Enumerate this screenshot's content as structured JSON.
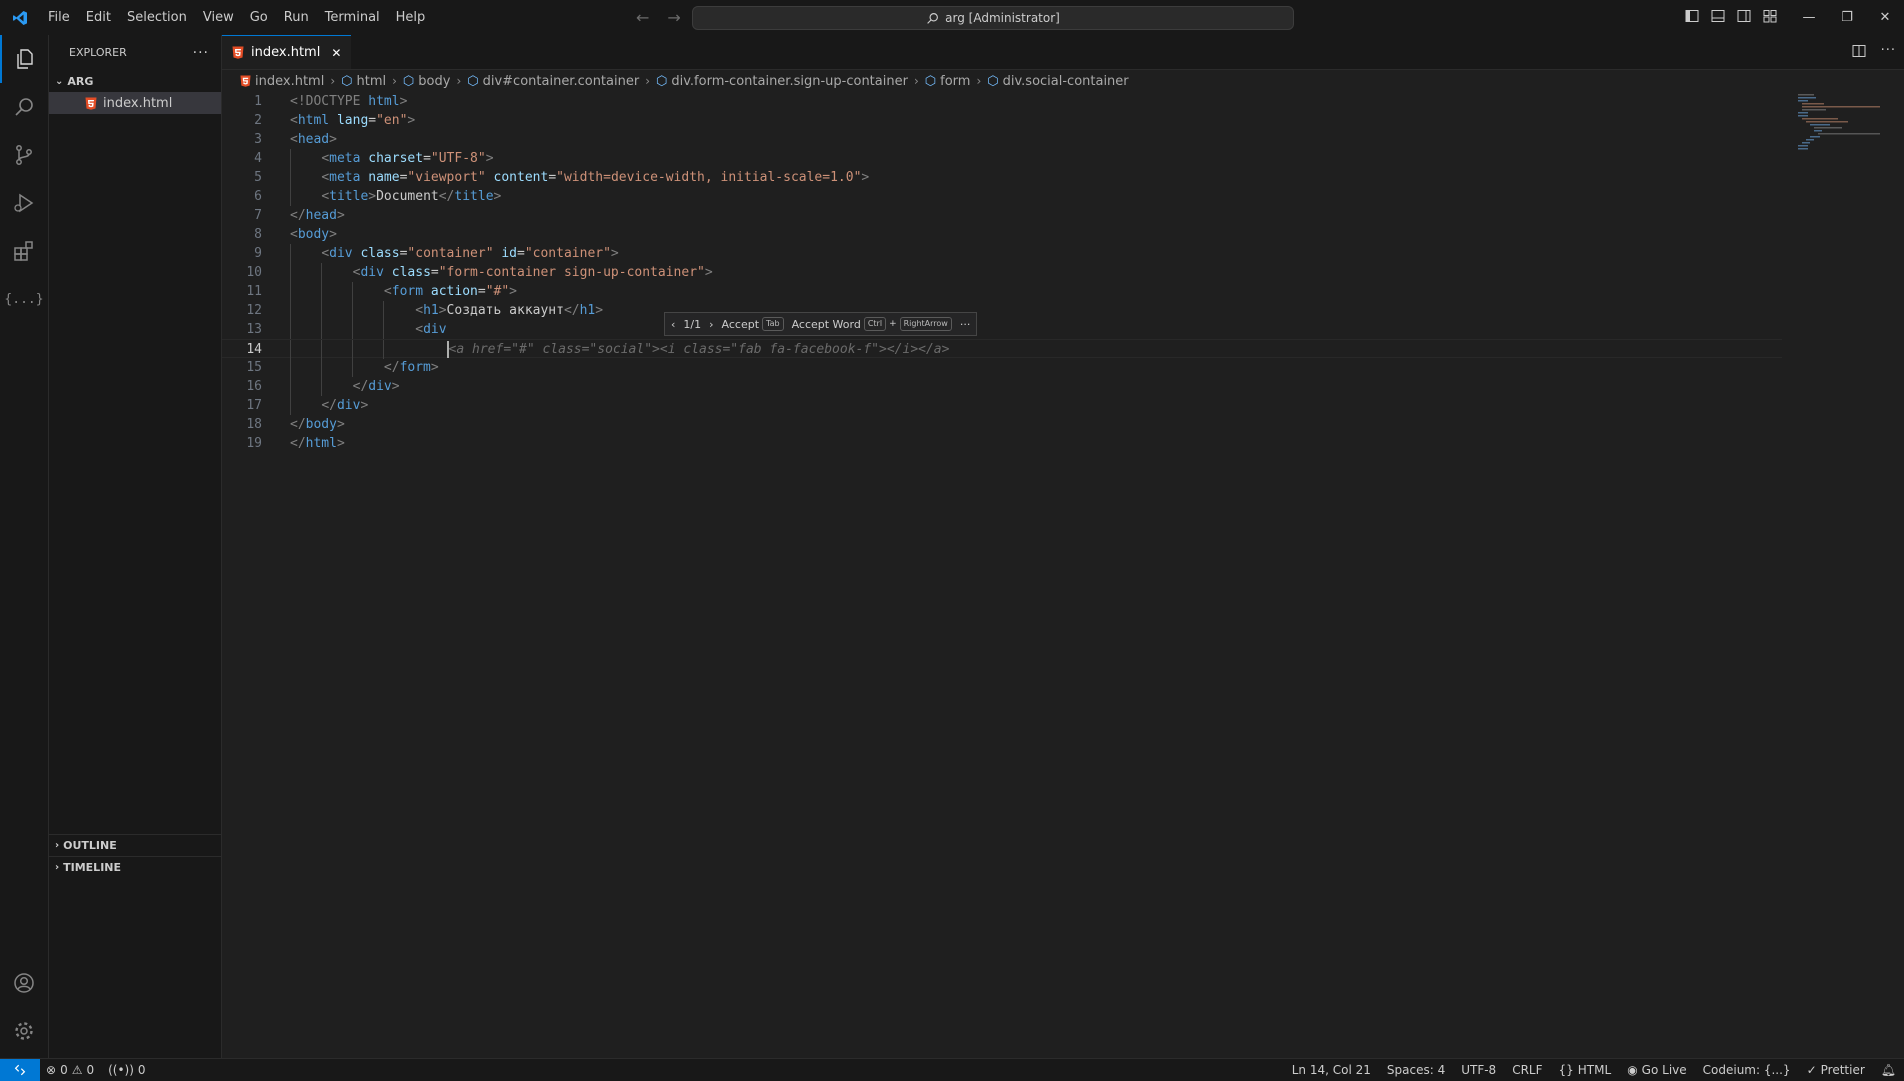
{
  "menu": [
    "File",
    "Edit",
    "Selection",
    "View",
    "Go",
    "Run",
    "Terminal",
    "Help"
  ],
  "command_center": "arg [Administrator]",
  "explorer": {
    "title": "EXPLORER",
    "folder": "ARG",
    "file": "index.html",
    "outline": "OUTLINE",
    "timeline": "TIMELINE"
  },
  "tab": {
    "label": "index.html"
  },
  "breadcrumb": [
    "index.html",
    "html",
    "body",
    "div#container.container",
    "div.form-container.sign-up-container",
    "form",
    "div.social-container"
  ],
  "code": {
    "l1_a": "<!DOCTYPE ",
    "l1_b": "html",
    "l1_c": ">",
    "l2_tag": "html",
    "l2_attr": "lang",
    "l2_val": "\"en\"",
    "l3_tag": "head",
    "l4_tag": "meta",
    "l4_attr": "charset",
    "l4_val": "\"UTF-8\"",
    "l5_tag": "meta",
    "l5_attr1": "name",
    "l5_val1": "\"viewport\"",
    "l5_attr2": "content",
    "l5_val2": "\"width=device-width, initial-scale=1.0\"",
    "l6_tag": "title",
    "l6_text": "Document",
    "l7_tag": "head",
    "l8_tag": "body",
    "l9_tag": "div",
    "l9_attr1": "class",
    "l9_val1": "\"container\"",
    "l9_attr2": "id",
    "l9_val2": "\"container\"",
    "l10_tag": "div",
    "l10_attr": "class",
    "l10_val": "\"form-container sign-up-container\"",
    "l11_tag": "form",
    "l11_attr": "action",
    "l11_val": "\"#\"",
    "l12_tag": "h1",
    "l12_text": "Создать аккаунт",
    "l13_tag": "div",
    "l14_ghost": "<a href=\"#\" class=\"social\"><i class=\"fab fa-facebook-f\"></i></a>",
    "l15_tag": "form",
    "l16_tag": "div",
    "l17_tag": "div",
    "l18_tag": "body",
    "l19_tag": "html"
  },
  "line_numbers": [
    "1",
    "2",
    "3",
    "4",
    "5",
    "6",
    "7",
    "8",
    "9",
    "10",
    "11",
    "12",
    "13",
    "14",
    "15",
    "16",
    "17",
    "18",
    "19"
  ],
  "suggestion": {
    "count": "1/1",
    "accept": "Accept",
    "accept_key": "Tab",
    "accept_word": "Accept Word",
    "ctrl_key": "Ctrl",
    "plus": "+",
    "arrow_key": "RightArrow",
    "more": "···"
  },
  "status": {
    "errors": "0",
    "warnings": "0",
    "ports": "0",
    "position": "Ln 14, Col 21",
    "spaces": "Spaces: 4",
    "encoding": "UTF-8",
    "eol": "CRLF",
    "language": "HTML",
    "golive": "Go Live",
    "codeium": "Codeium: {...}",
    "prettier": "Prettier"
  },
  "colors": {
    "accent": "#0078d4",
    "html_icon": "#e44d26",
    "tag": "#569cd6",
    "attr": "#9cdcfe",
    "string": "#ce9178"
  }
}
